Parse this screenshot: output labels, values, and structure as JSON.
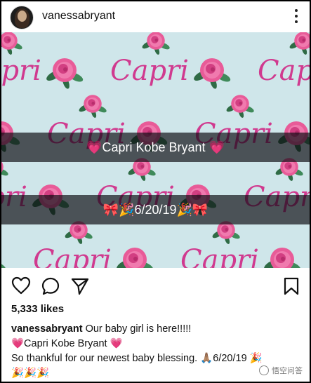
{
  "header": {
    "username": "vanessabryant"
  },
  "post_image": {
    "pattern_word": "Capri",
    "overlay_1": "💗Capri Kobe Bryant 💗",
    "overlay_2": "🎀🎉6/20/19🎉🎀"
  },
  "actions": {
    "like_icon": "heart-icon",
    "comment_icon": "comment-icon",
    "share_icon": "send-icon",
    "save_icon": "bookmark-icon"
  },
  "likes": {
    "text": "5,333 likes"
  },
  "caption": {
    "username": "vanessabryant",
    "line_1": " Our baby girl is here!!!!!",
    "line_2": "💗Capri Kobe Bryant 💗",
    "line_3": "So thankful for our newest baby blessing. 🙏🏽6/20/19 🎉",
    "line_4": "🎉🎉🎉"
  },
  "watermark": {
    "text": "悟空问答"
  },
  "colors": {
    "pattern_bg": "#cfe6ea",
    "script_pink": "#d03a8f",
    "rose": "#e85b98",
    "leaf": "#2f6b45",
    "overlay": "#0c0c12"
  }
}
